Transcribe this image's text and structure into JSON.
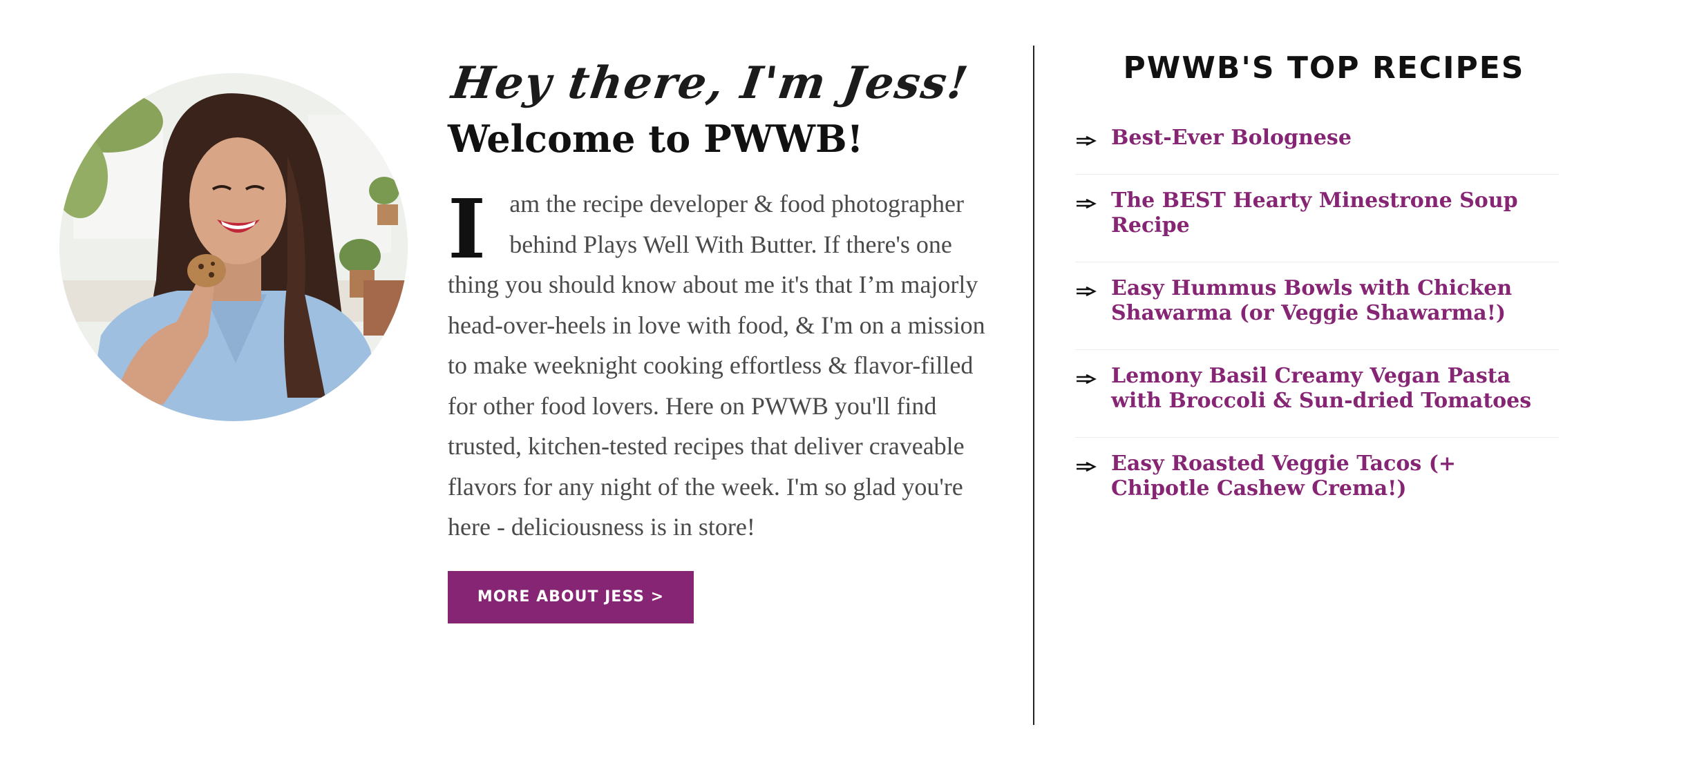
{
  "intro": {
    "greeting": "Hey there, I'm Jess!",
    "heading": "Welcome to PWWB!",
    "bio_dropcap": "I",
    "bio_text": "am the recipe developer & food photographer behind Plays Well With Butter. If there's one thing you should know about me it's that I’m majorly head-over-heels in love with food, & I'm on a mission to make weeknight cooking effortless & flavor-filled for other food lovers. Here on PWWB you'll find trusted, kitchen-tested recipes that deliver craveable flavors for any night of the week. I'm so glad you're here - deliciousness is in store!",
    "button_label": "MORE ABOUT JESS >"
  },
  "top_recipes": {
    "title": "PWWB'S TOP RECIPES",
    "items": [
      {
        "label": "Best-Ever Bolognese"
      },
      {
        "label": "The BEST Hearty Minestrone Soup Recipe"
      },
      {
        "label": "Easy Hummus Bowls with Chicken Shawarma (or Veggie Shawarma!)"
      },
      {
        "label": "Lemony Basil Creamy Vegan Pasta with Broccoli & Sun-dried Tomatoes"
      },
      {
        "label": "Easy Roasted Veggie Tacos (+ Chipotle Cashew Crema!)"
      }
    ]
  },
  "colors": {
    "accent": "#862574",
    "body_text": "#4a4a4a",
    "heading": "#111111"
  },
  "icons": {
    "portrait": "jess-portrait-photo",
    "list_bullet": "arrow-bullet-icon"
  }
}
